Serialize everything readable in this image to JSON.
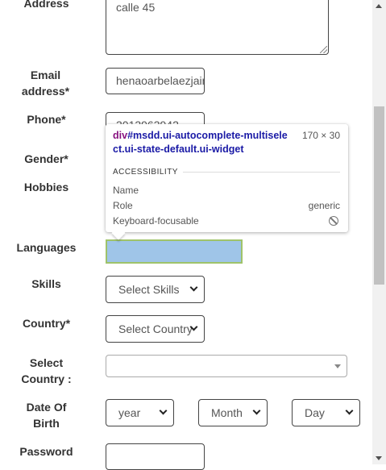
{
  "form": {
    "address_label": "Address",
    "address_value": "calle 45",
    "email_label": "Email address*",
    "email_value": "henaoarbelaezjaime@gmail.com",
    "phone_label": "Phone*",
    "phone_value": "3013963942",
    "gender_label": "Gender*",
    "hobbies_label": "Hobbies",
    "languages_label": "Languages",
    "skills_label": "Skills",
    "skills_value": "Select Skills",
    "country_label": "Country*",
    "country_value": "Select Country",
    "select_country_label": "Select Country :",
    "dob_label": "Date Of Birth",
    "dob_year": "year",
    "dob_month": "Month",
    "dob_day": "Day",
    "password_label": "Password"
  },
  "inspector": {
    "selector_tag": "div",
    "selector_rest": "#msdd.ui-autocomplete-multiselect.ui-state-default.ui-widget",
    "dimensions": "170 × 30",
    "section_title": "ACCESSIBILITY",
    "name_label": "Name",
    "name_value": "",
    "role_label": "Role",
    "role_value": "generic",
    "keyboard_label": "Keyboard-focusable",
    "keyboard_icon": "not-allowed-icon"
  },
  "colors": {
    "highlight_fill": "#9fc5e8",
    "highlight_border": "#9fc36a",
    "tag_color": "#881280",
    "selector_color": "#1a1aa6"
  }
}
